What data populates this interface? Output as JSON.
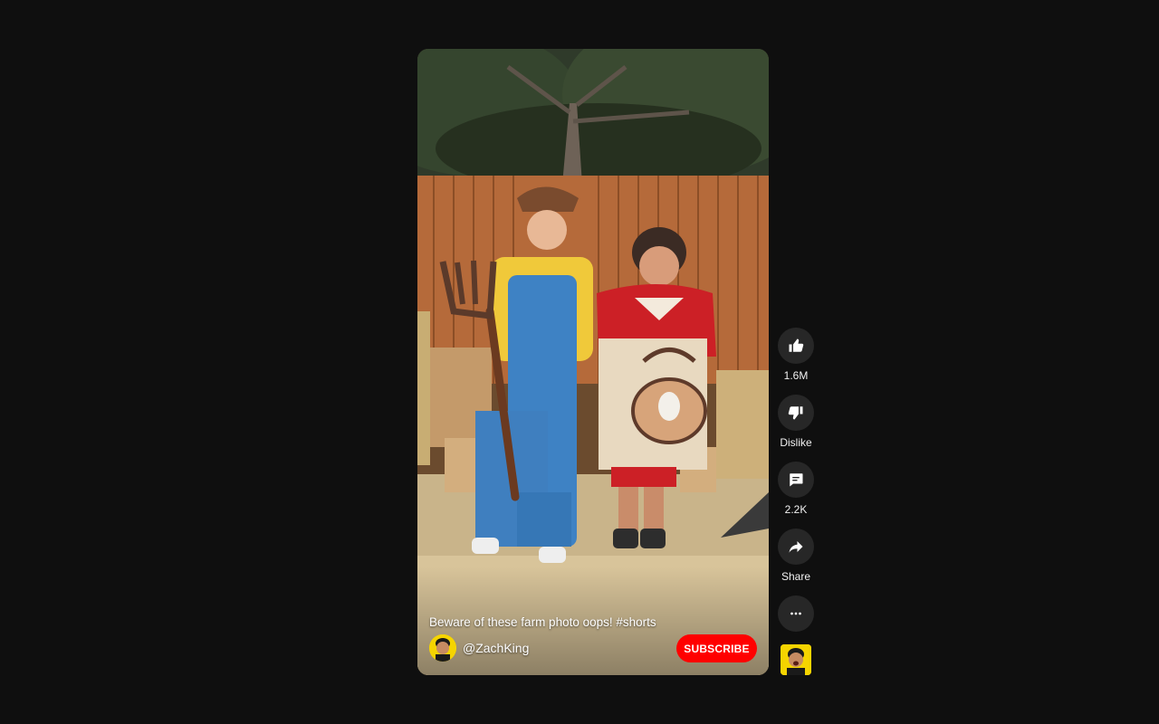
{
  "video": {
    "caption": "Beware of these farm photo oops! #shorts",
    "channel_handle": "@ZachKing",
    "subscribe_label": "SUBSCRIBE"
  },
  "actions": {
    "like": {
      "icon": "thumbs-up-icon",
      "label": "1.6M"
    },
    "dislike": {
      "icon": "thumbs-down-icon",
      "label": "Dislike"
    },
    "comments": {
      "icon": "comment-icon",
      "label": "2.2K"
    },
    "share": {
      "icon": "share-icon",
      "label": "Share"
    },
    "more": {
      "icon": "more-horizontal-icon"
    }
  },
  "colors": {
    "background": "#0f0f0f",
    "subscribe": "#ff0000",
    "action_button": "#272727",
    "avatar_bg": "#f5d400"
  }
}
